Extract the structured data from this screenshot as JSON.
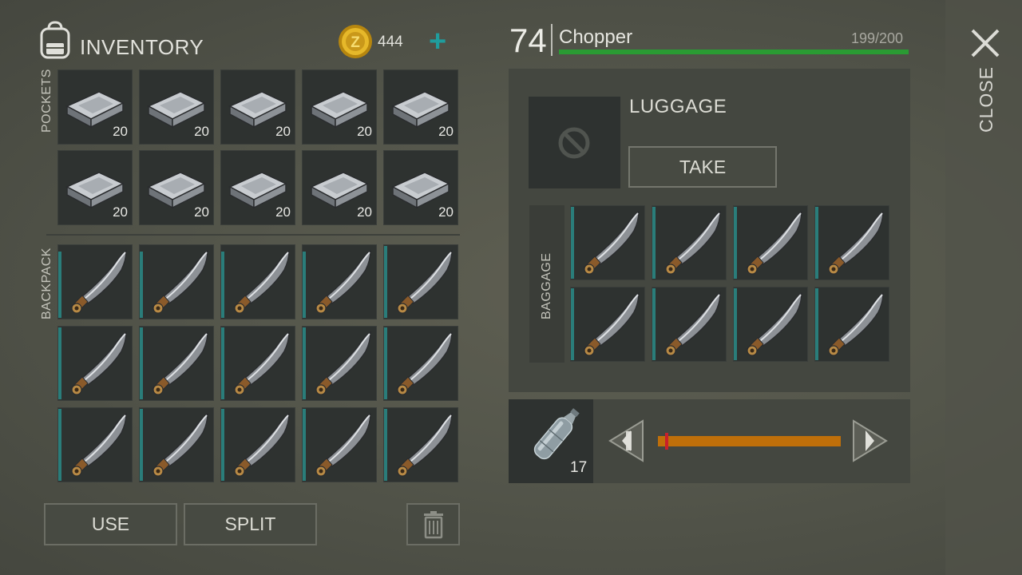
{
  "inventory": {
    "title": "INVENTORY",
    "coins": "444",
    "add_label": "+",
    "pockets_label": "POCKETS",
    "backpack_label": "BACKPACK",
    "pockets": [
      {
        "item": "iron-plate",
        "count": "20"
      },
      {
        "item": "iron-plate",
        "count": "20"
      },
      {
        "item": "iron-plate",
        "count": "20"
      },
      {
        "item": "iron-plate",
        "count": "20"
      },
      {
        "item": "iron-plate",
        "count": "20"
      },
      {
        "item": "iron-plate",
        "count": "20"
      },
      {
        "item": "iron-plate",
        "count": "20"
      },
      {
        "item": "iron-plate",
        "count": "20"
      },
      {
        "item": "iron-plate",
        "count": "20"
      },
      {
        "item": "iron-plate",
        "count": "20"
      }
    ],
    "backpack": [
      {
        "item": "chopper",
        "durability": 0.92
      },
      {
        "item": "chopper",
        "durability": 0.92
      },
      {
        "item": "chopper",
        "durability": 0.92
      },
      {
        "item": "chopper",
        "durability": 0.92
      },
      {
        "item": "chopper",
        "durability": 1.0
      },
      {
        "item": "chopper",
        "durability": 1.0
      },
      {
        "item": "chopper",
        "durability": 1.0
      },
      {
        "item": "chopper",
        "durability": 1.0
      },
      {
        "item": "chopper",
        "durability": 1.0
      },
      {
        "item": "chopper",
        "durability": 1.0
      },
      {
        "item": "chopper",
        "durability": 1.0
      },
      {
        "item": "chopper",
        "durability": 1.0
      },
      {
        "item": "chopper",
        "durability": 1.0
      },
      {
        "item": "chopper",
        "durability": 1.0
      },
      {
        "item": "chopper",
        "durability": 1.0
      }
    ],
    "use_label": "USE",
    "split_label": "SPLIT"
  },
  "selected_item": {
    "level": "74",
    "name": "Chopper",
    "durability_text": "199/200",
    "durability_fraction": 0.995
  },
  "container": {
    "title": "LUGGAGE",
    "take_label": "TAKE",
    "baggage_label": "BAGGAGE",
    "items": [
      {
        "item": "chopper",
        "durability": 1.0
      },
      {
        "item": "chopper",
        "durability": 1.0
      },
      {
        "item": "chopper",
        "durability": 1.0
      },
      {
        "item": "chopper",
        "durability": 1.0
      },
      {
        "item": "chopper",
        "durability": 1.0
      },
      {
        "item": "chopper",
        "durability": 1.0
      },
      {
        "item": "chopper",
        "durability": 1.0
      },
      {
        "item": "chopper",
        "durability": 1.0
      }
    ]
  },
  "transfer": {
    "item": "water-bottle",
    "count": "17",
    "slider_fraction": 0.04
  },
  "close_label": "CLOSE",
  "colors": {
    "accent_teal": "#1f9d9d",
    "durability_green": "#2a9b33",
    "slider_orange": "#bf6f0a",
    "slider_handle_red": "#c9202a"
  },
  "icons": [
    "backpack-icon",
    "coin-icon",
    "plus-icon",
    "iron-plate-icon",
    "chopper-icon",
    "no-entry-icon",
    "water-bottle-icon",
    "arrow-left-icon",
    "arrow-right-icon",
    "trash-icon",
    "close-icon"
  ]
}
